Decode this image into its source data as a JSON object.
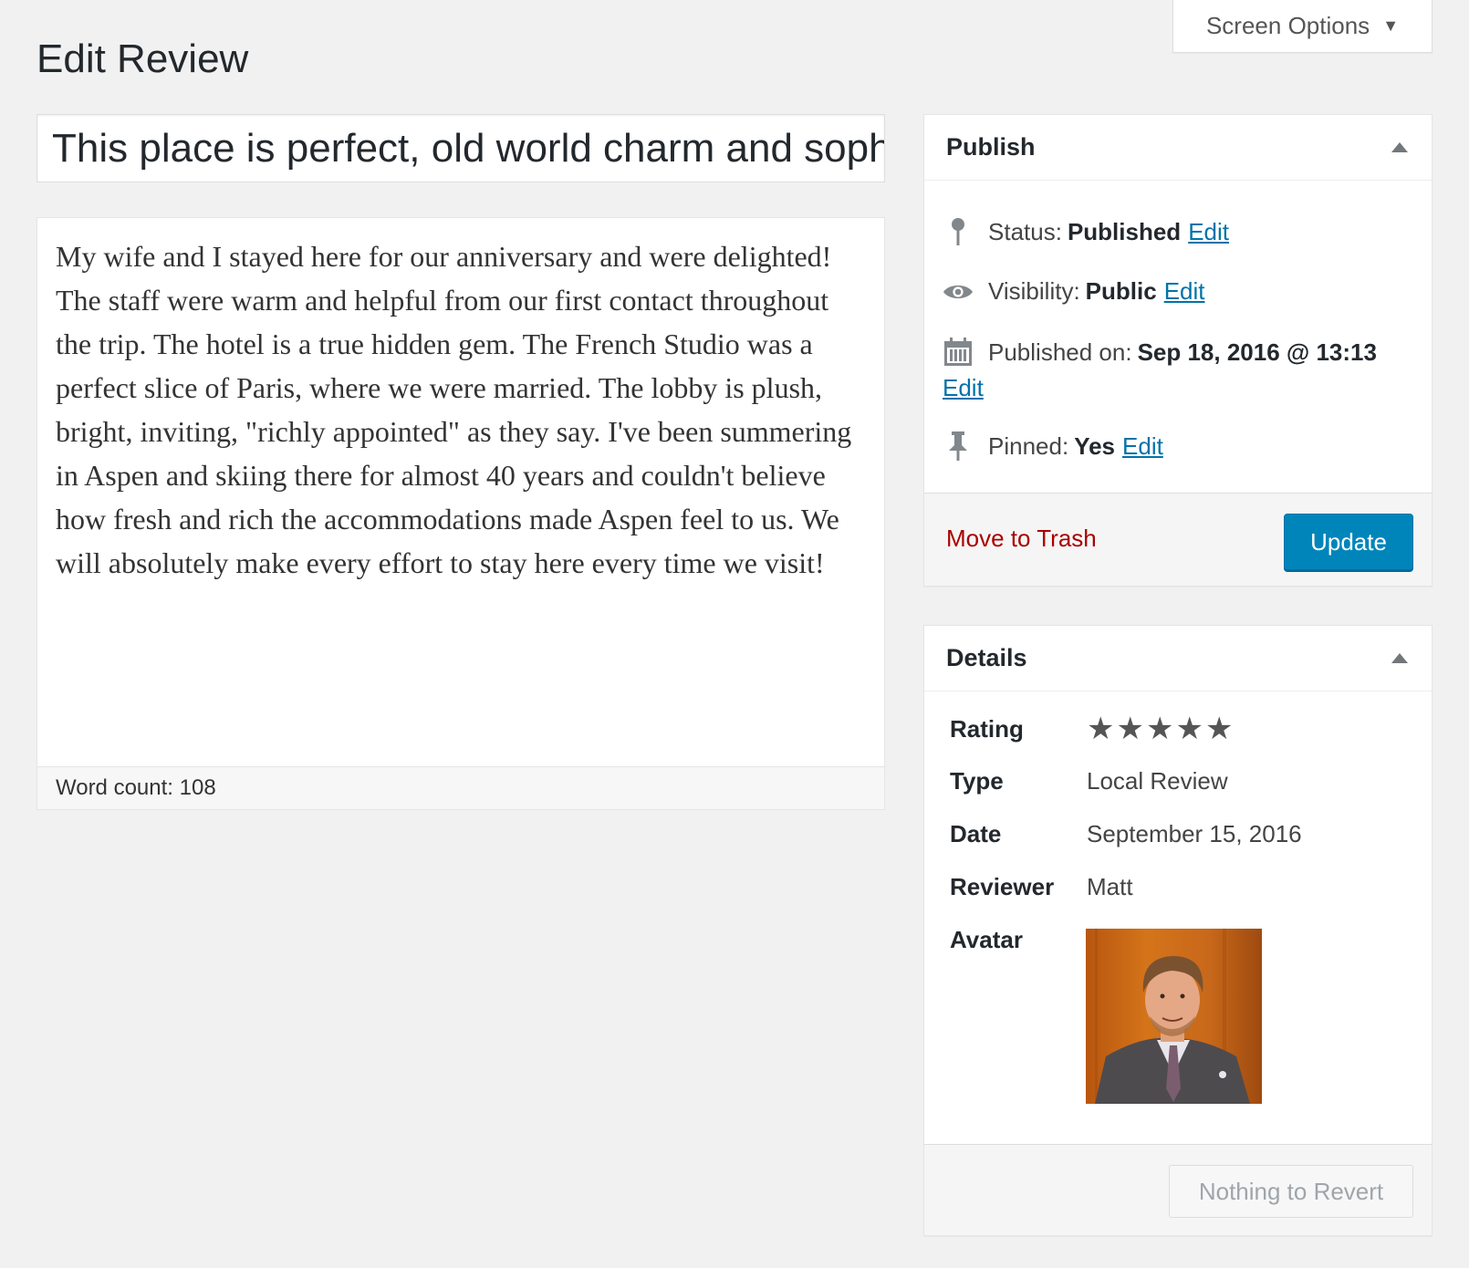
{
  "screen_options": {
    "label": "Screen Options",
    "caret_icon": "triangle-down-icon"
  },
  "page_title": "Edit Review",
  "title_field": {
    "value": "This place is perfect, old world charm and soph"
  },
  "editor": {
    "content": "My wife and I stayed here for our anniversary and were delighted! The staff were warm and helpful from our first contact throughout the trip. The hotel is a true hidden gem. The French Studio was a perfect slice of Paris, where we were married. The lobby is plush, bright, inviting, \"richly appointed\" as they say. I've been summering in Aspen and skiing there for almost 40 years and couldn't believe how fresh and rich the accommodations made Aspen feel to us. We will absolutely make every effort to stay here every time we visit!",
    "word_count_label": "Word count:",
    "word_count": "108"
  },
  "publish": {
    "title": "Publish",
    "status": {
      "label": "Status:",
      "value": "Published",
      "edit": "Edit",
      "icon": "location-pin-icon"
    },
    "visibility": {
      "label": "Visibility:",
      "value": "Public",
      "edit": "Edit",
      "icon": "eye-icon"
    },
    "published_on": {
      "label": "Published on:",
      "value": "Sep 18, 2016 @ 13:13",
      "edit": "Edit",
      "icon": "calendar-icon"
    },
    "pinned": {
      "label": "Pinned:",
      "value": "Yes",
      "edit": "Edit",
      "icon": "pushpin-icon"
    },
    "trash_label": "Move to Trash",
    "update_label": "Update"
  },
  "details": {
    "title": "Details",
    "rating_label": "Rating",
    "rating": 5,
    "rating_max": 5,
    "type_label": "Type",
    "type_value": "Local Review",
    "date_label": "Date",
    "date_value": "September 15, 2016",
    "reviewer_label": "Reviewer",
    "reviewer_value": "Matt",
    "avatar_label": "Avatar",
    "revert_label": "Nothing to Revert"
  },
  "colors": {
    "accent": "#0085ba",
    "link": "#0073aa",
    "danger": "#aa0000",
    "background": "#f1f1f1"
  }
}
